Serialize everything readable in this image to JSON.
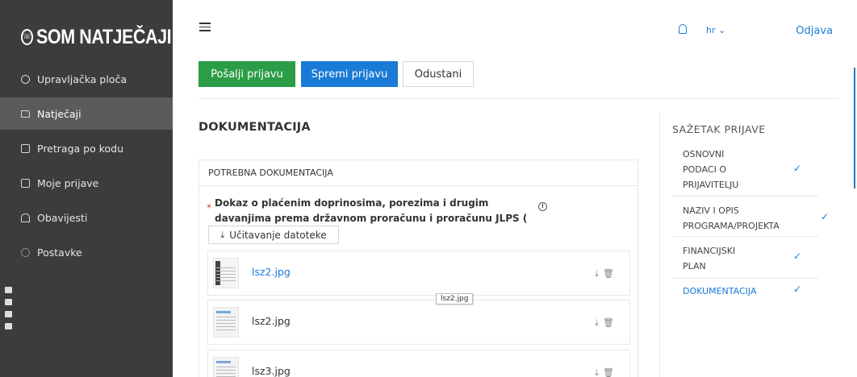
{
  "brand": {
    "logo_icon": "phone-circle-icon",
    "name": "SOM NATJEČAJI"
  },
  "sidebar": {
    "items": [
      {
        "label": "Upravljačka ploča",
        "icon": "dashboard-icon"
      },
      {
        "label": "Natječaji",
        "icon": "folder-icon",
        "active": true
      },
      {
        "label": "Pretraga po kodu",
        "icon": "document-icon"
      },
      {
        "label": "Moje prijave",
        "icon": "document-icon"
      },
      {
        "label": "Obavijesti",
        "icon": "bell-icon"
      },
      {
        "label": "Postavke",
        "icon": "gear-icon"
      }
    ]
  },
  "header": {
    "language": "hr",
    "logout_label": "Odjava"
  },
  "actions": {
    "submit_label": "Pošalji prijavu",
    "save_label": "Spremi prijavu",
    "cancel_label": "Odustani"
  },
  "main": {
    "section_title": "DOKUMENTACIJA",
    "card_title": "POTREBNA DOKUMENTACIJA",
    "requirement_label": "Dokaz o plaćenim doprinosima, porezima i drugim davanjima prema državnom proračunu i proračunu JLPS ( Porezna uprava)",
    "upload_label": "Učitavanje datoteke",
    "files": [
      {
        "name": "lsz2.jpg"
      },
      {
        "name": "lsz2.jpg"
      },
      {
        "name": "lsz3.jpg"
      }
    ],
    "tooltip": "lsz2.jpg"
  },
  "summary": {
    "title": "SAŽETAK PRIJAVE",
    "items": [
      {
        "label": "OSNOVNI PODACI O PRIJAVITELJU",
        "done": true
      },
      {
        "label": "NAZIV I OPIS PROGRAMA/PROJEKTA",
        "done": true
      },
      {
        "label": "FINANCIJSKI PLAN",
        "done": true
      },
      {
        "label": "DOKUMENTACIJA",
        "done": true,
        "active": true
      }
    ]
  },
  "colors": {
    "sidebar": "#3c3c3c",
    "accent": "#1a7bd6",
    "success": "#2a9d46"
  }
}
